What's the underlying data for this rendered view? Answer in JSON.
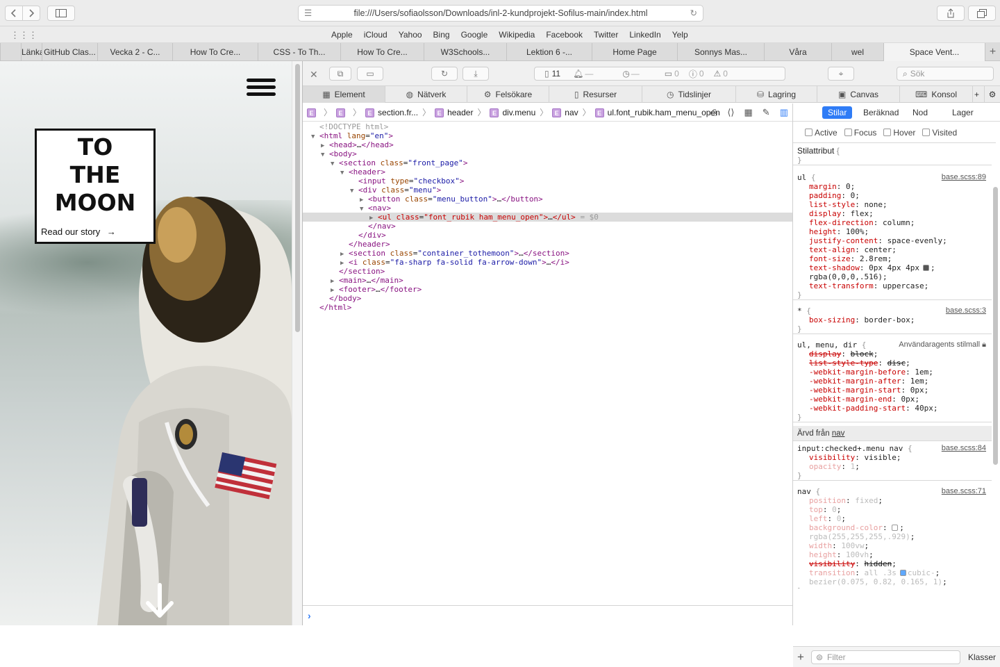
{
  "browser": {
    "url": "file:///Users/sofiaolsson/Downloads/inl-2-kundprojekt-Sofilus-main/index.html",
    "favorites": [
      "Apple",
      "iCloud",
      "Yahoo",
      "Bing",
      "Google",
      "Wikipedia",
      "Facebook",
      "Twitter",
      "LinkedIn",
      "Yelp"
    ],
    "tabs": [
      "Länkar |",
      "GitHub Clas...",
      "Vecka 2 - C...",
      "How To Cre...",
      "CSS - To Th...",
      "How To Cre...",
      "W3Schools...",
      "Lektion 6 -...",
      "Home Page",
      "Sonnys Mas...",
      "Våra",
      "wel",
      "Space Vent..."
    ],
    "active_tab": "Space Vent..."
  },
  "site": {
    "title_lines": [
      "TO",
      "THE",
      "MOON"
    ],
    "story_link": "Read our story",
    "story_arrow": "→"
  },
  "devtools": {
    "resource_count": "11",
    "message_counts": {
      "logs": "0",
      "errors": "0",
      "warnings": "0"
    },
    "timer_placeholders": [
      "—",
      "—"
    ],
    "search_placeholder": "Sök",
    "tabs": [
      "Element",
      "Nätverk",
      "Felsökare",
      "Resurser",
      "Tidslinjer",
      "Lagring",
      "Canvas",
      "Konsol"
    ],
    "active_tab": "Element",
    "breadcrumb": [
      "E",
      "E",
      "section.fr...",
      "header",
      "div.menu",
      "nav",
      "ul.font_rubik.ham_menu_open"
    ],
    "sidebar_tabs": [
      "Stilar",
      "Beräknad",
      "Nod",
      "Lager"
    ],
    "active_sidebar_tab": "Stilar",
    "pseudo_classes": [
      "Active",
      "Focus",
      "Hover",
      "Visited"
    ],
    "filter_placeholder": "Filter",
    "classes_label": "Klasser",
    "inherited_label": "Ärvd från",
    "inherited_from": "nav",
    "style_attr_label": "Stilattribut"
  },
  "dom_tree": [
    {
      "t": "comment",
      "text": "<!DOCTYPE html>"
    },
    {
      "t": "open",
      "tag": "html",
      "attrs": [
        [
          "lang",
          "en"
        ]
      ],
      "close": false
    },
    {
      "t": "collapsed",
      "tag": "head"
    },
    {
      "t": "open",
      "tag": "body",
      "attrs": []
    },
    {
      "t": "open",
      "tag": "section",
      "attrs": [
        [
          "class",
          "front_page"
        ]
      ]
    },
    {
      "t": "open",
      "tag": "header",
      "attrs": []
    },
    {
      "t": "leaf",
      "tag": "input",
      "attrs": [
        [
          "type",
          "checkbox"
        ]
      ]
    },
    {
      "t": "open",
      "tag": "div",
      "attrs": [
        [
          "class",
          "menu"
        ]
      ]
    },
    {
      "t": "collapsed",
      "tag": "button",
      "attrs": [
        [
          "class",
          "menu_button"
        ]
      ]
    },
    {
      "t": "open",
      "tag": "nav",
      "attrs": []
    },
    {
      "t": "collapsed",
      "tag": "ul",
      "attrs": [
        [
          "class",
          "font_rubik ham_menu_open"
        ]
      ],
      "selected": true,
      "suffix": "= $0"
    },
    {
      "t": "close",
      "tag": "nav"
    },
    {
      "t": "close",
      "tag": "div"
    },
    {
      "t": "close",
      "tag": "header"
    },
    {
      "t": "collapsed",
      "tag": "section",
      "attrs": [
        [
          "class",
          "container_tothemoon"
        ]
      ]
    },
    {
      "t": "collapsed",
      "tag": "i",
      "attrs": [
        [
          "class",
          "fa-sharp fa-solid fa-arrow-down"
        ]
      ]
    },
    {
      "t": "close",
      "tag": "section"
    },
    {
      "t": "collapsed",
      "tag": "main"
    },
    {
      "t": "collapsed",
      "tag": "footer"
    },
    {
      "t": "close",
      "tag": "body"
    },
    {
      "t": "close",
      "tag": "html"
    }
  ],
  "css_rules": [
    {
      "selector": "ul",
      "source": "base.scss:89",
      "decls": [
        [
          "margin",
          "0"
        ],
        [
          "padding",
          "0"
        ],
        [
          "list-style",
          "none"
        ],
        [
          "display",
          "flex"
        ],
        [
          "flex-direction",
          "column"
        ],
        [
          "height",
          "100%"
        ],
        [
          "justify-content",
          "space-evenly"
        ],
        [
          "text-align",
          "center"
        ],
        [
          "font-size",
          "2.8rem"
        ],
        [
          "text-shadow",
          "0px 4px 4px"
        ],
        [
          "",
          "rgba(0,0,0,.516)"
        ],
        [
          "text-transform",
          "uppercase"
        ]
      ]
    },
    {
      "selector": "*",
      "source": "base.scss:3",
      "decls": [
        [
          "box-sizing",
          "border-box"
        ]
      ]
    },
    {
      "selector": "ul, menu, dir",
      "source": "Användaragents stilmall",
      "decls": [
        [
          "display",
          "block"
        ],
        [
          "list-style-type",
          "disc"
        ],
        [
          "-webkit-margin-before",
          "1em"
        ],
        [
          "-webkit-margin-after",
          "1em"
        ],
        [
          "-webkit-margin-start",
          "0px"
        ],
        [
          "-webkit-margin-end",
          "0px"
        ],
        [
          "-webkit-padding-start",
          "40px"
        ]
      ]
    },
    {
      "selector": "input:checked+.menu nav",
      "source": "base.scss:84",
      "decls": [
        [
          "visibility",
          "visible"
        ],
        [
          "opacity",
          "1"
        ]
      ]
    },
    {
      "selector": "nav",
      "source": "base.scss:71",
      "decls": [
        [
          "position",
          "fixed"
        ],
        [
          "top",
          "0"
        ],
        [
          "left",
          "0"
        ],
        [
          "background-color",
          ""
        ],
        [
          "",
          "rgba(255,255,255,.929)"
        ],
        [
          "width",
          "100vw"
        ],
        [
          "height",
          "100vh"
        ],
        [
          "visibility",
          "hidden"
        ],
        [
          "transition",
          "all .3s"
        ],
        [
          "",
          "bezier(0.075, 0.82, 0.165, 1)"
        ]
      ]
    }
  ],
  "css_extra": {
    "cubic_prefix": "cubic-"
  }
}
